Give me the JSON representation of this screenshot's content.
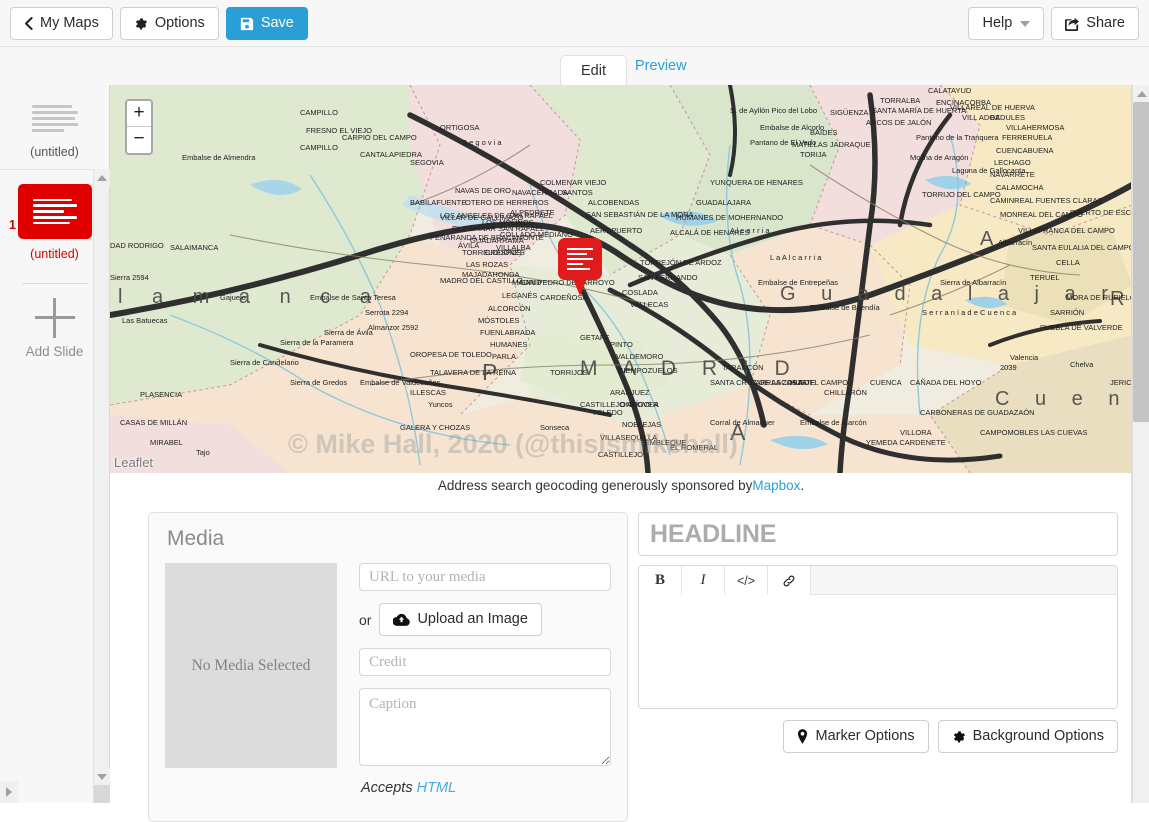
{
  "toolbar": {
    "my_maps_label": "My Maps",
    "my_maps_icon": "chevron-left-icon",
    "options_label": "Options",
    "options_icon": "gear-icon",
    "save_label": "Save",
    "save_icon": "floppy-disk-icon",
    "help_label": "Help",
    "help_caret_icon": "caret-down-icon",
    "share_label": "Share",
    "share_icon": "share-square-icon"
  },
  "tabs": {
    "edit_label": "Edit",
    "preview_label": "Preview",
    "active": "Edit"
  },
  "sidebar": {
    "title_slide": {
      "caption": "(untitled)",
      "thumb_icon": "text-lines-icon"
    },
    "slides": [
      {
        "number": "1",
        "caption": "(untitled)",
        "thumb_icon": "text-lines-icon",
        "selected": true,
        "color": "#e00000"
      }
    ],
    "add_slide_label": "Add Slide",
    "add_slide_icon": "plus-icon"
  },
  "map": {
    "zoom_in_label": "+",
    "zoom_out_label": "−",
    "attribution": "Leaflet",
    "watermark": "© Mike Hall, 2020  (@thisismikehall)",
    "marker_icon": "text-bubble-marker-icon",
    "geocode_credit_prefix": "Address search geocoding generously sponsored by ",
    "geocode_credit_link": "Mapbox",
    "geocode_credit_suffix": "."
  },
  "media": {
    "panel_title": "Media",
    "no_media_text": "No Media Selected",
    "url_placeholder": "URL to your media",
    "or_label": "or",
    "upload_label": "Upload an Image",
    "upload_icon": "cloud-upload-icon",
    "credit_placeholder": "Credit",
    "caption_placeholder": "Caption",
    "accepts_text": "Accepts ",
    "accepts_link": "HTML"
  },
  "text_editor": {
    "headline_placeholder": "HEADLINE",
    "body_value": "",
    "rte_buttons": [
      {
        "label": "B",
        "name": "bold-button"
      },
      {
        "label": "I",
        "name": "italic-button"
      },
      {
        "label": "</>",
        "name": "html-source-button"
      },
      {
        "label": "🔗",
        "name": "link-button"
      }
    ],
    "marker_options_label": "Marker Options",
    "marker_options_icon": "map-pin-icon",
    "background_options_label": "Background Options",
    "background_options_icon": "gear-icon"
  },
  "colors": {
    "accent": "#2a9fd6",
    "slide_red": "#e00000",
    "link": "#2a9fd6",
    "toolbar_bg": "#f7f7f7"
  }
}
